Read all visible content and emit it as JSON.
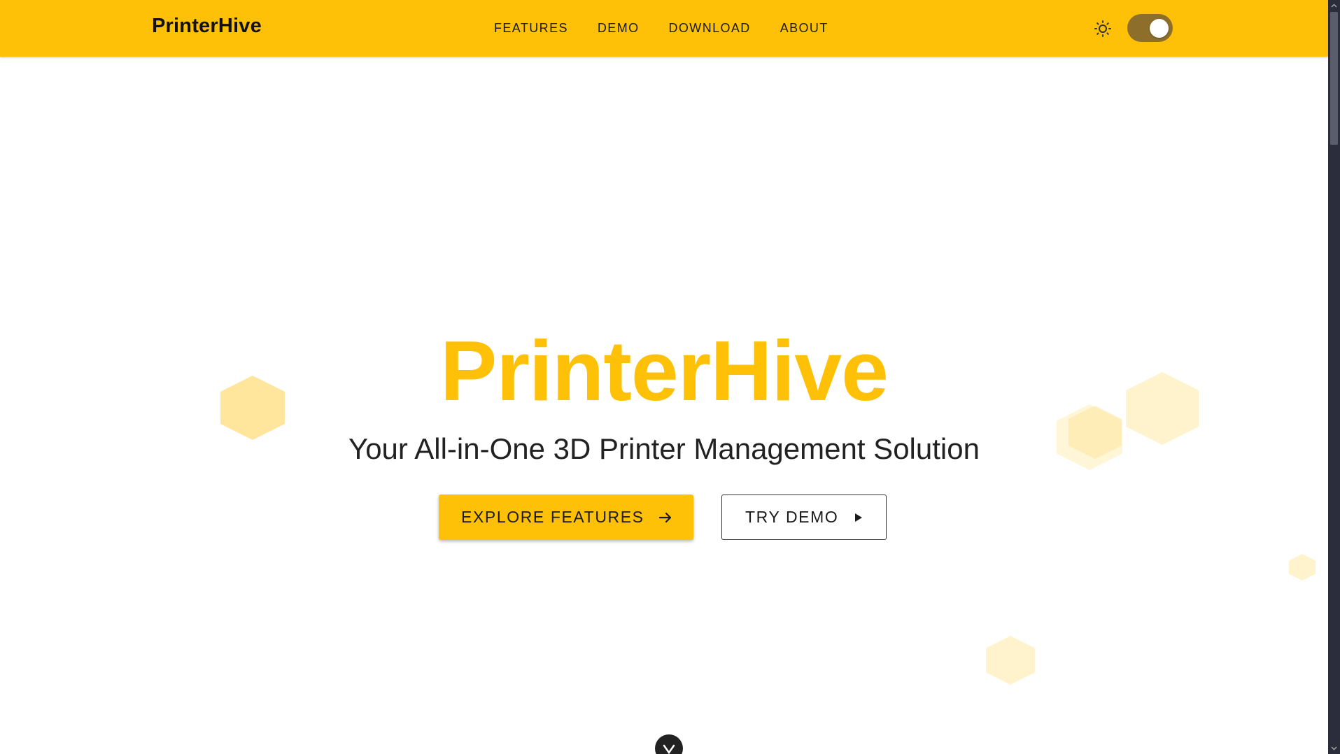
{
  "header": {
    "brand": "PrinterHive",
    "nav": [
      {
        "label": "FEATURES"
      },
      {
        "label": "DEMO"
      },
      {
        "label": "DOWNLOAD"
      },
      {
        "label": "ABOUT"
      }
    ],
    "theme_icon": "sun-icon",
    "dark_mode_toggle": {
      "state": "on"
    }
  },
  "hero": {
    "title": "PrinterHive",
    "subtitle": "Your All-in-One 3D Printer Management Solution",
    "primary_button": {
      "label": "EXPLORE FEATURES",
      "icon": "arrow-right-icon"
    },
    "secondary_button": {
      "label": "TRY DEMO",
      "icon": "play-icon"
    },
    "scroll_icon": "chevron-down-icon"
  },
  "colors": {
    "accent": "#ffc107",
    "toggle_track": "#8d6e2b",
    "hexagon_light": "#fff3cd",
    "hexagon_mid": "#ffe69c"
  }
}
